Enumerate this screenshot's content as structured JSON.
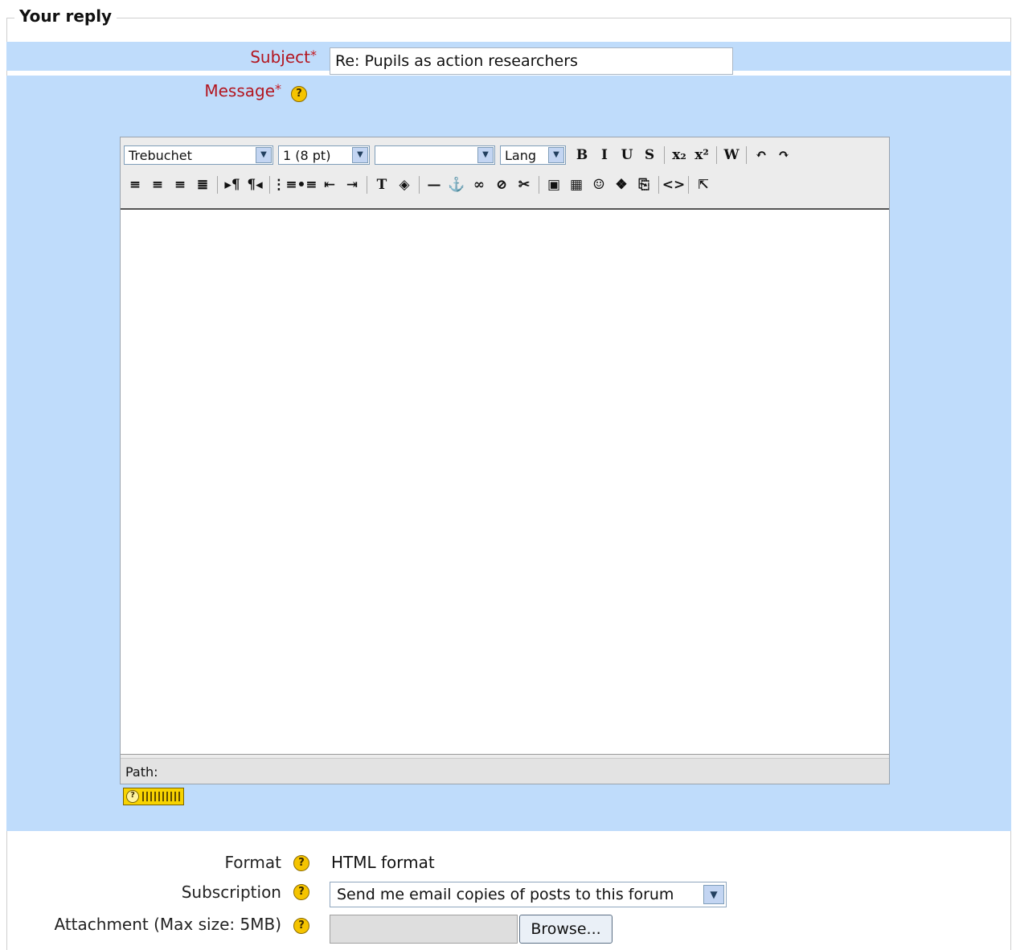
{
  "legend": "Your reply",
  "subject": {
    "label": "Subject",
    "value": "Re: Pupils as action researchers"
  },
  "message": {
    "label": "Message"
  },
  "toolbar": {
    "font": "Trebuchet",
    "size": "1 (8 pt)",
    "style": "",
    "lang": "Lang",
    "buttons_row1": [
      {
        "name": "bold-button",
        "glyph": "B"
      },
      {
        "name": "italic-button",
        "glyph": "I"
      },
      {
        "name": "underline-button",
        "glyph": "U"
      },
      {
        "name": "strikethrough-button",
        "glyph": "S"
      },
      {
        "name": "subscript-button",
        "glyph": "x₂"
      },
      {
        "name": "superscript-button",
        "glyph": "x²"
      },
      {
        "name": "clean-word-button",
        "glyph": "W"
      },
      {
        "name": "undo-button",
        "glyph": "↶"
      },
      {
        "name": "redo-button",
        "glyph": "↷"
      }
    ],
    "buttons_row2": [
      {
        "name": "align-left-button",
        "glyph": "≡"
      },
      {
        "name": "align-center-button",
        "glyph": "≡"
      },
      {
        "name": "align-right-button",
        "glyph": "≡"
      },
      {
        "name": "justify-button",
        "glyph": "≣"
      },
      {
        "name": "ltr-button",
        "glyph": "▸¶"
      },
      {
        "name": "rtl-button",
        "glyph": "¶◂"
      },
      {
        "name": "ordered-list-button",
        "glyph": "⋮≡"
      },
      {
        "name": "unordered-list-button",
        "glyph": "•≡"
      },
      {
        "name": "outdent-button",
        "glyph": "⇤"
      },
      {
        "name": "indent-button",
        "glyph": "⇥"
      },
      {
        "name": "text-color-button",
        "glyph": "T"
      },
      {
        "name": "background-color-button",
        "glyph": "◈"
      },
      {
        "name": "horizontal-rule-button",
        "glyph": "—"
      },
      {
        "name": "anchor-button",
        "glyph": "⚓"
      },
      {
        "name": "link-button",
        "glyph": "∞"
      },
      {
        "name": "unlink-button",
        "glyph": "⊘"
      },
      {
        "name": "nolink-button",
        "glyph": "✂"
      },
      {
        "name": "insert-image-button",
        "glyph": "▣"
      },
      {
        "name": "insert-table-button",
        "glyph": "▦"
      },
      {
        "name": "smiley-button",
        "glyph": "☺"
      },
      {
        "name": "special-char-button",
        "glyph": "❖"
      },
      {
        "name": "search-replace-button",
        "glyph": "⎘"
      },
      {
        "name": "html-source-button",
        "glyph": "<>"
      },
      {
        "name": "fullscreen-button",
        "glyph": "⇱"
      }
    ]
  },
  "path_label": "Path:",
  "format": {
    "label": "Format",
    "value": "HTML format"
  },
  "subscription": {
    "label": "Subscription",
    "value": "Send me email copies of posts to this forum"
  },
  "attachment": {
    "label": "Attachment (Max size: 5MB)",
    "button": "Browse..."
  },
  "colors": {
    "band": "#bfdcfb",
    "required": "#b3151f",
    "help": "#f5c400"
  }
}
